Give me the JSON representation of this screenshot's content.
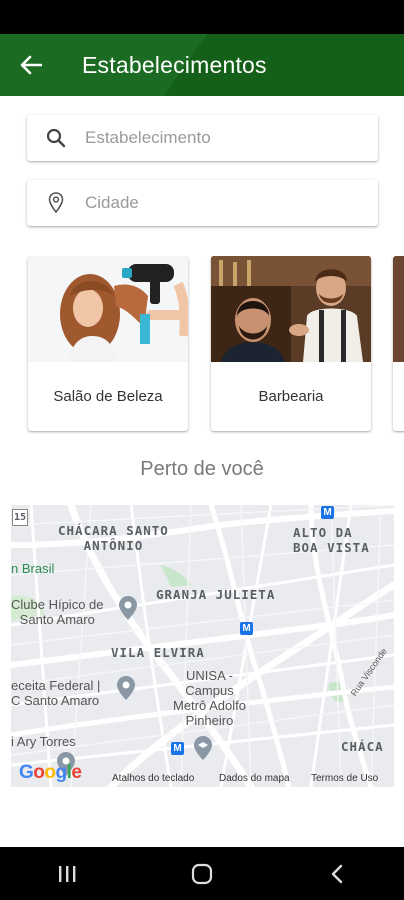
{
  "header": {
    "title": "Estabelecimentos"
  },
  "search": {
    "establishment_placeholder": "Estabelecimento",
    "city_placeholder": "Cidade"
  },
  "categories": [
    {
      "label": "Salão de Beleza",
      "icon": "hair-salon-photo"
    },
    {
      "label": "Barbearia",
      "icon": "barbershop-photo"
    }
  ],
  "nearby": {
    "title": "Perto de você"
  },
  "map": {
    "labels": {
      "chacara": "CHÁCARA SANTO\nANTÔNIO",
      "alto": "ALTO DA\nBOA VISTA",
      "brasil": "n Brasil",
      "clube": "Clube Hípico de\nSanto Amaro",
      "granja": "GRANJA JULIETA",
      "vila": "VILA ELVIRA",
      "receita": "eceita Federal |\nC Santo Amaro",
      "unisa": "UNISA -\nCampus\nMetrô Adolfo\nPinheiro",
      "ary": "i Ary Torres",
      "chaca2": "CHÁCA",
      "rua": "Rua Visconde",
      "route": "15"
    },
    "google": "Google",
    "footer": {
      "shortcuts": "Atalhos do teclado",
      "data": "Dados do mapa",
      "terms": "Termos de Uso"
    },
    "colors": {
      "roads": "#ffffff",
      "park": "#c8e6c9",
      "water": "#aadaff",
      "metro": "#1a73e8"
    }
  },
  "colors": {
    "app_bar": "#1c6b22",
    "accent": "#156019"
  }
}
